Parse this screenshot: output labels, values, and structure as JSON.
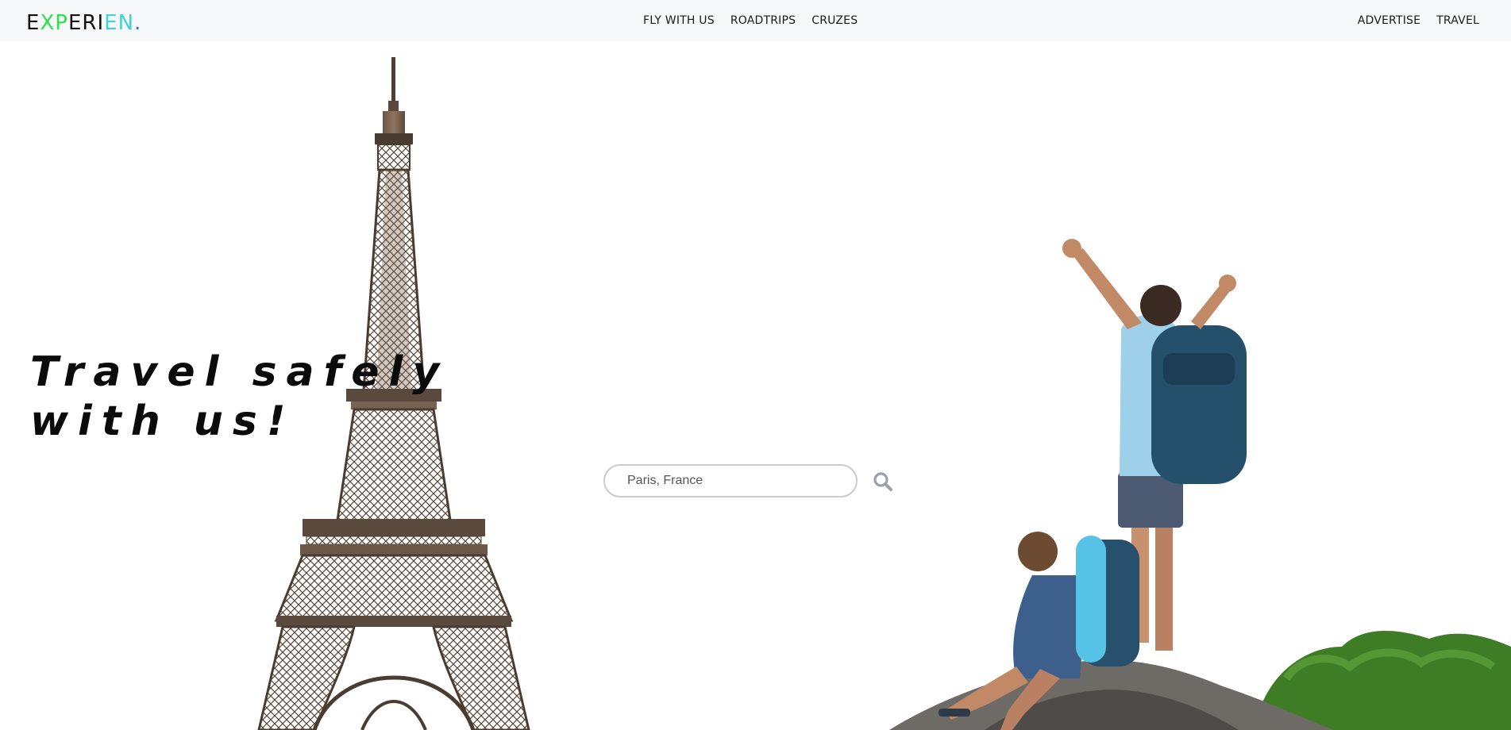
{
  "navbar": {
    "logo": {
      "letters": [
        {
          "char": "E",
          "color": "#111111"
        },
        {
          "char": "X",
          "color": "#2ee04a"
        },
        {
          "char": "P",
          "color": "#2ee04a"
        },
        {
          "char": "E",
          "color": "#111111"
        },
        {
          "char": "R",
          "color": "#111111"
        },
        {
          "char": "I",
          "color": "#111111"
        },
        {
          "char": "E",
          "color": "#3fd2d8"
        },
        {
          "char": "N",
          "color": "#3fd2d8"
        },
        {
          "char": ".",
          "color": "#2a6fd6"
        }
      ]
    },
    "center_links": [
      "FLY WITH US",
      "ROADTRIPS",
      "CRUZES"
    ],
    "right_links": [
      "ADVERTISE",
      "TRAVEL"
    ]
  },
  "hero": {
    "line1": "Travel safely",
    "line2": "with us!"
  },
  "search": {
    "value": "Paris, France",
    "placeholder": "Paris, France",
    "icon": "search-icon",
    "icon_color": "#9aa0a8"
  },
  "colors": {
    "navbar_bg": "#f7f8f9",
    "text": "#111111"
  }
}
